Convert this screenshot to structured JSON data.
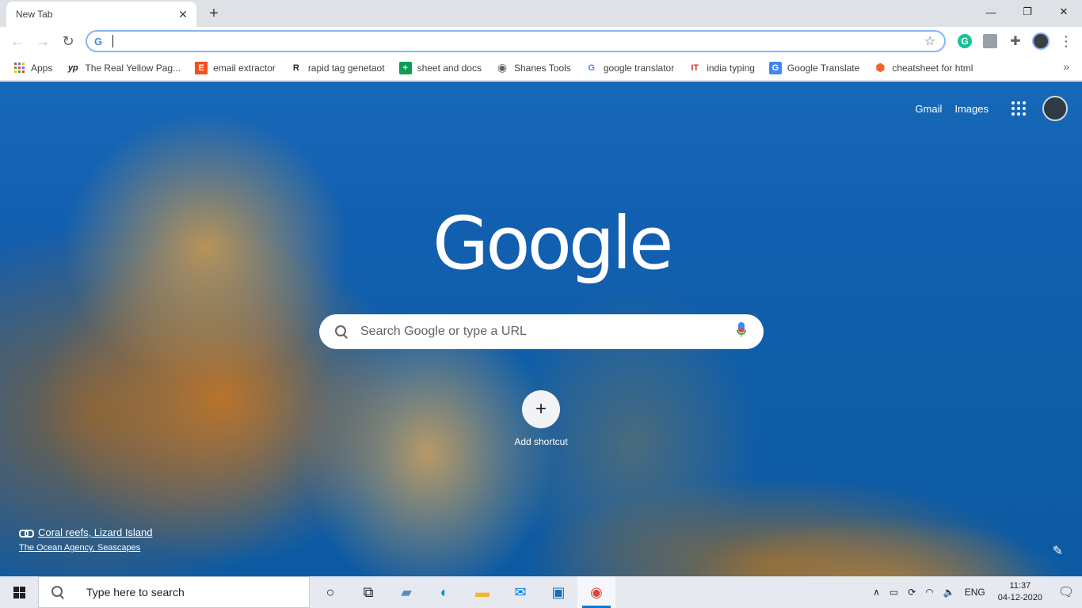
{
  "tab": {
    "title": "New Tab",
    "close": "✕",
    "new_tab": "+"
  },
  "window_controls": {
    "minimize": "—",
    "maximize": "❐",
    "close": "✕"
  },
  "toolbar": {
    "back": "←",
    "forward": "→",
    "reload": "↻",
    "omnibox_value": "",
    "star": "☆",
    "extensions_icon": "✚",
    "menu": "⋮",
    "grammarly": "G"
  },
  "bookmarks": {
    "items": [
      {
        "label": "Apps",
        "icon": "apps-grid-icon",
        "color": "#ea4335"
      },
      {
        "label": "The Real Yellow Pag...",
        "glyph": "yp",
        "color": "#202124"
      },
      {
        "label": "email extractor",
        "glyph": "E",
        "color": "#f25022"
      },
      {
        "label": "rapid tag genetaot",
        "glyph": "R",
        "color": "#202124"
      },
      {
        "label": "sheet and docs",
        "glyph": "+",
        "color": "#0f9d58"
      },
      {
        "label": "Shanes Tools",
        "glyph": "◉",
        "color": "#5f6368"
      },
      {
        "label": "google translator",
        "glyph": "G",
        "color": "#4285f4"
      },
      {
        "label": "india typing",
        "glyph": "IT",
        "color": "#d93025"
      },
      {
        "label": "Google Translate",
        "glyph": "G",
        "color": "#4285f4"
      },
      {
        "label": "cheatsheet for html",
        "glyph": "⬢",
        "color": "#f06529"
      }
    ],
    "more": "»"
  },
  "ntp": {
    "gmail": "Gmail",
    "images": "Images",
    "logo": "Google",
    "search_placeholder": "Search Google or type a URL",
    "add_shortcut_icon": "+",
    "add_shortcut": "Add shortcut",
    "attribution_title": "Coral reefs, Lizard Island",
    "attribution_credit": "The Ocean Agency, Seascapes",
    "customize_icon": "✎"
  },
  "taskbar": {
    "search_text": "Type here to search",
    "icons": [
      {
        "name": "cortana-icon",
        "glyph": "○"
      },
      {
        "name": "task-view-icon",
        "glyph": "⧉"
      },
      {
        "name": "photos-app-icon",
        "glyph": "▰"
      },
      {
        "name": "edge-icon",
        "glyph": "◐"
      },
      {
        "name": "file-explorer-icon",
        "glyph": "▬"
      },
      {
        "name": "mail-icon",
        "glyph": "✉"
      },
      {
        "name": "remote-desktop-icon",
        "glyph": "▣"
      },
      {
        "name": "chrome-icon",
        "glyph": "◉"
      }
    ],
    "tray": {
      "chevron": "∧",
      "battery": "▭",
      "network_sync": "⟳",
      "wifi": "◠",
      "volume": "🔈",
      "language": "ENG"
    },
    "time": "11:37",
    "date": "04-12-2020",
    "notifications": "🗨"
  },
  "colors": {
    "accent": "#4285f4",
    "omnibox_focus": "#8ab4f8",
    "taskbar_active": "#0078d4"
  }
}
